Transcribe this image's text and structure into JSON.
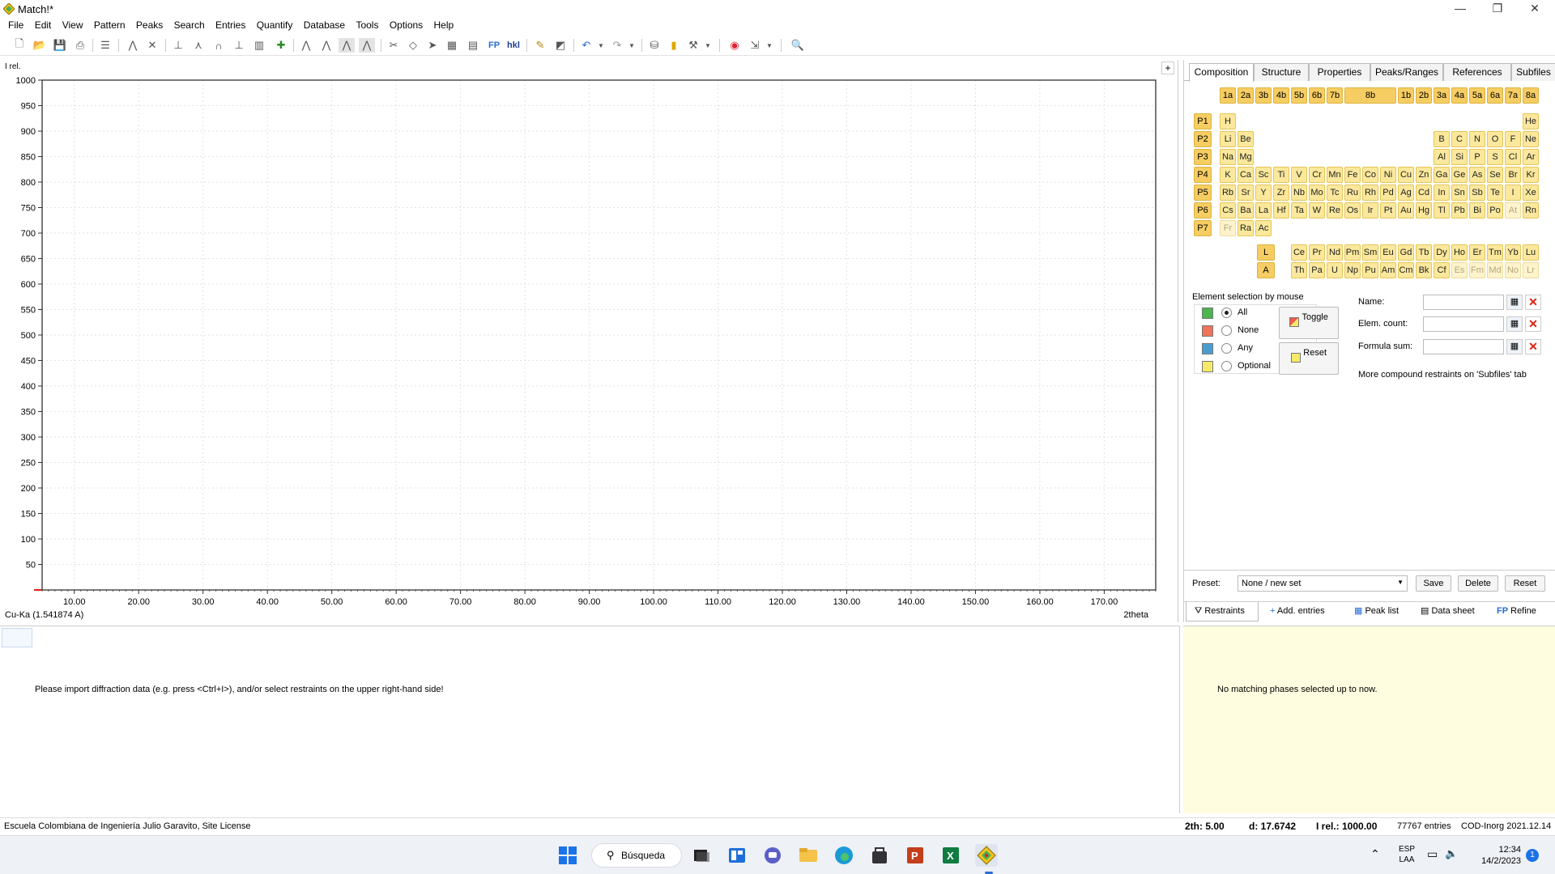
{
  "window": {
    "title": "Match!*",
    "minimize": "—",
    "maximize": "❐",
    "close": "✕"
  },
  "menu": [
    {
      "label": "File"
    },
    {
      "label": "Edit"
    },
    {
      "label": "View"
    },
    {
      "label": "Pattern"
    },
    {
      "label": "Peaks"
    },
    {
      "label": "Search"
    },
    {
      "label": "Entries"
    },
    {
      "label": "Quantify"
    },
    {
      "label": "Database"
    },
    {
      "label": "Tools"
    },
    {
      "label": "Options"
    },
    {
      "label": "Help"
    }
  ],
  "toolbar": {
    "fp": "FP",
    "hkl": "hkl"
  },
  "chart_data": {
    "type": "line",
    "series": [],
    "ylabel": "I rel.",
    "xlabel": "2theta",
    "xlim": [
      5,
      178
    ],
    "ylim": [
      0,
      1000
    ],
    "xticks": [
      "10.00",
      "20.00",
      "30.00",
      "40.00",
      "50.00",
      "60.00",
      "70.00",
      "80.00",
      "90.00",
      "100.00",
      "110.00",
      "120.00",
      "130.00",
      "140.00",
      "150.00",
      "160.00",
      "170.00"
    ],
    "xtick_values": [
      10,
      20,
      30,
      40,
      50,
      60,
      70,
      80,
      90,
      100,
      110,
      120,
      130,
      140,
      150,
      160,
      170
    ],
    "yticks": [
      "1000",
      "950",
      "900",
      "850",
      "800",
      "750",
      "700",
      "650",
      "600",
      "550",
      "500",
      "450",
      "400",
      "350",
      "300",
      "250",
      "200",
      "150",
      "100",
      "50"
    ],
    "ytick_values": [
      1000,
      950,
      900,
      850,
      800,
      750,
      700,
      650,
      600,
      550,
      500,
      450,
      400,
      350,
      300,
      250,
      200,
      150,
      100,
      50
    ],
    "grid": true,
    "wavelength_label": "Cu-Ka (1.541874 A)"
  },
  "right_panel": {
    "tabs": [
      "Composition",
      "Structure",
      "Properties",
      "Peaks/Ranges",
      "References",
      "Subfiles"
    ],
    "groups_left": [
      "1a",
      "2a",
      "3b",
      "4b",
      "5b",
      "6b",
      "7b"
    ],
    "group_8b": "8b",
    "groups_right": [
      "1b",
      "2b",
      "3a",
      "4a",
      "5a",
      "6a",
      "7a",
      "8a"
    ],
    "periods": [
      "P1",
      "P2",
      "P3",
      "P4",
      "P5",
      "P6",
      "P7"
    ],
    "series_labels": [
      "L",
      "A"
    ],
    "selection_title": "Element selection by mouse",
    "selection_options": [
      "All",
      "None",
      "Any",
      "Optional"
    ],
    "toggle_label": "Toggle",
    "reset_label": "Reset",
    "name_label": "Name:",
    "elem_count_label": "Elem. count:",
    "formula_sum_label": "Formula sum:",
    "more_restraints": "More compound restraints on 'Subfiles' tab",
    "preset_label": "Preset:",
    "preset_value": "None / new set",
    "save_label": "Save",
    "delete_label": "Delete",
    "preset_reset_label": "Reset",
    "bottom_tabs": [
      "Restraints",
      "Add. entries",
      "Peak list",
      "Data sheet",
      "Refine"
    ],
    "refine_prefix": "FP"
  },
  "messages": {
    "import_hint": "Please import diffraction data (e.g. press <Ctrl+I>), and/or select restraints on the upper right-hand side!",
    "no_phases": "No matching phases selected up to now."
  },
  "status": {
    "license": "Escuela Colombiana de Ingeniería Julio Garavito, Site License",
    "two_theta": "2th:  5.00",
    "d": "d: 17.6742",
    "irel": "I rel.: 1000.00",
    "entries": "77767 entries",
    "db": "COD-Inorg 2021.12.14"
  },
  "taskbar": {
    "search": "Búsqueda",
    "lang1": "ESP",
    "lang2": "LAA",
    "time": "12:34",
    "date": "14/2/2023",
    "notif": "1"
  }
}
